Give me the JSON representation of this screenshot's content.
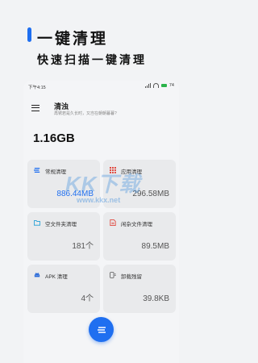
{
  "promo": {
    "title": "一键清理",
    "subtitle": "快速扫描一键清理"
  },
  "statusbar": {
    "time": "下午4:15",
    "battery": "74"
  },
  "header": {
    "title": "清浊",
    "subtitle": "再锈若是久长时，又岂在朝朝暮暮?"
  },
  "total": "1.16GB",
  "cards": [
    {
      "label": "常规清理",
      "value": "886.44MB",
      "icon": "layers-icon",
      "color": "#1f6ff0"
    },
    {
      "label": "应用清理",
      "value": "296.58MB",
      "icon": "grid-icon",
      "color": "#e0483e"
    },
    {
      "label": "空文件夹清理",
      "value": "181个",
      "icon": "folder-icon",
      "color": "#1f9fd6"
    },
    {
      "label": "闲杂文件清理",
      "value": "89.5MB",
      "icon": "file-icon",
      "color": "#e0483e"
    },
    {
      "label": "APK 清理",
      "value": "4个",
      "icon": "android-icon",
      "color": "#2a6ad8"
    },
    {
      "label": "卸载残留",
      "value": "39.8KB",
      "icon": "uninstall-icon",
      "color": "#555555"
    }
  ],
  "watermark": {
    "mark": "KK下载",
    "url": "www.kkx.net"
  }
}
